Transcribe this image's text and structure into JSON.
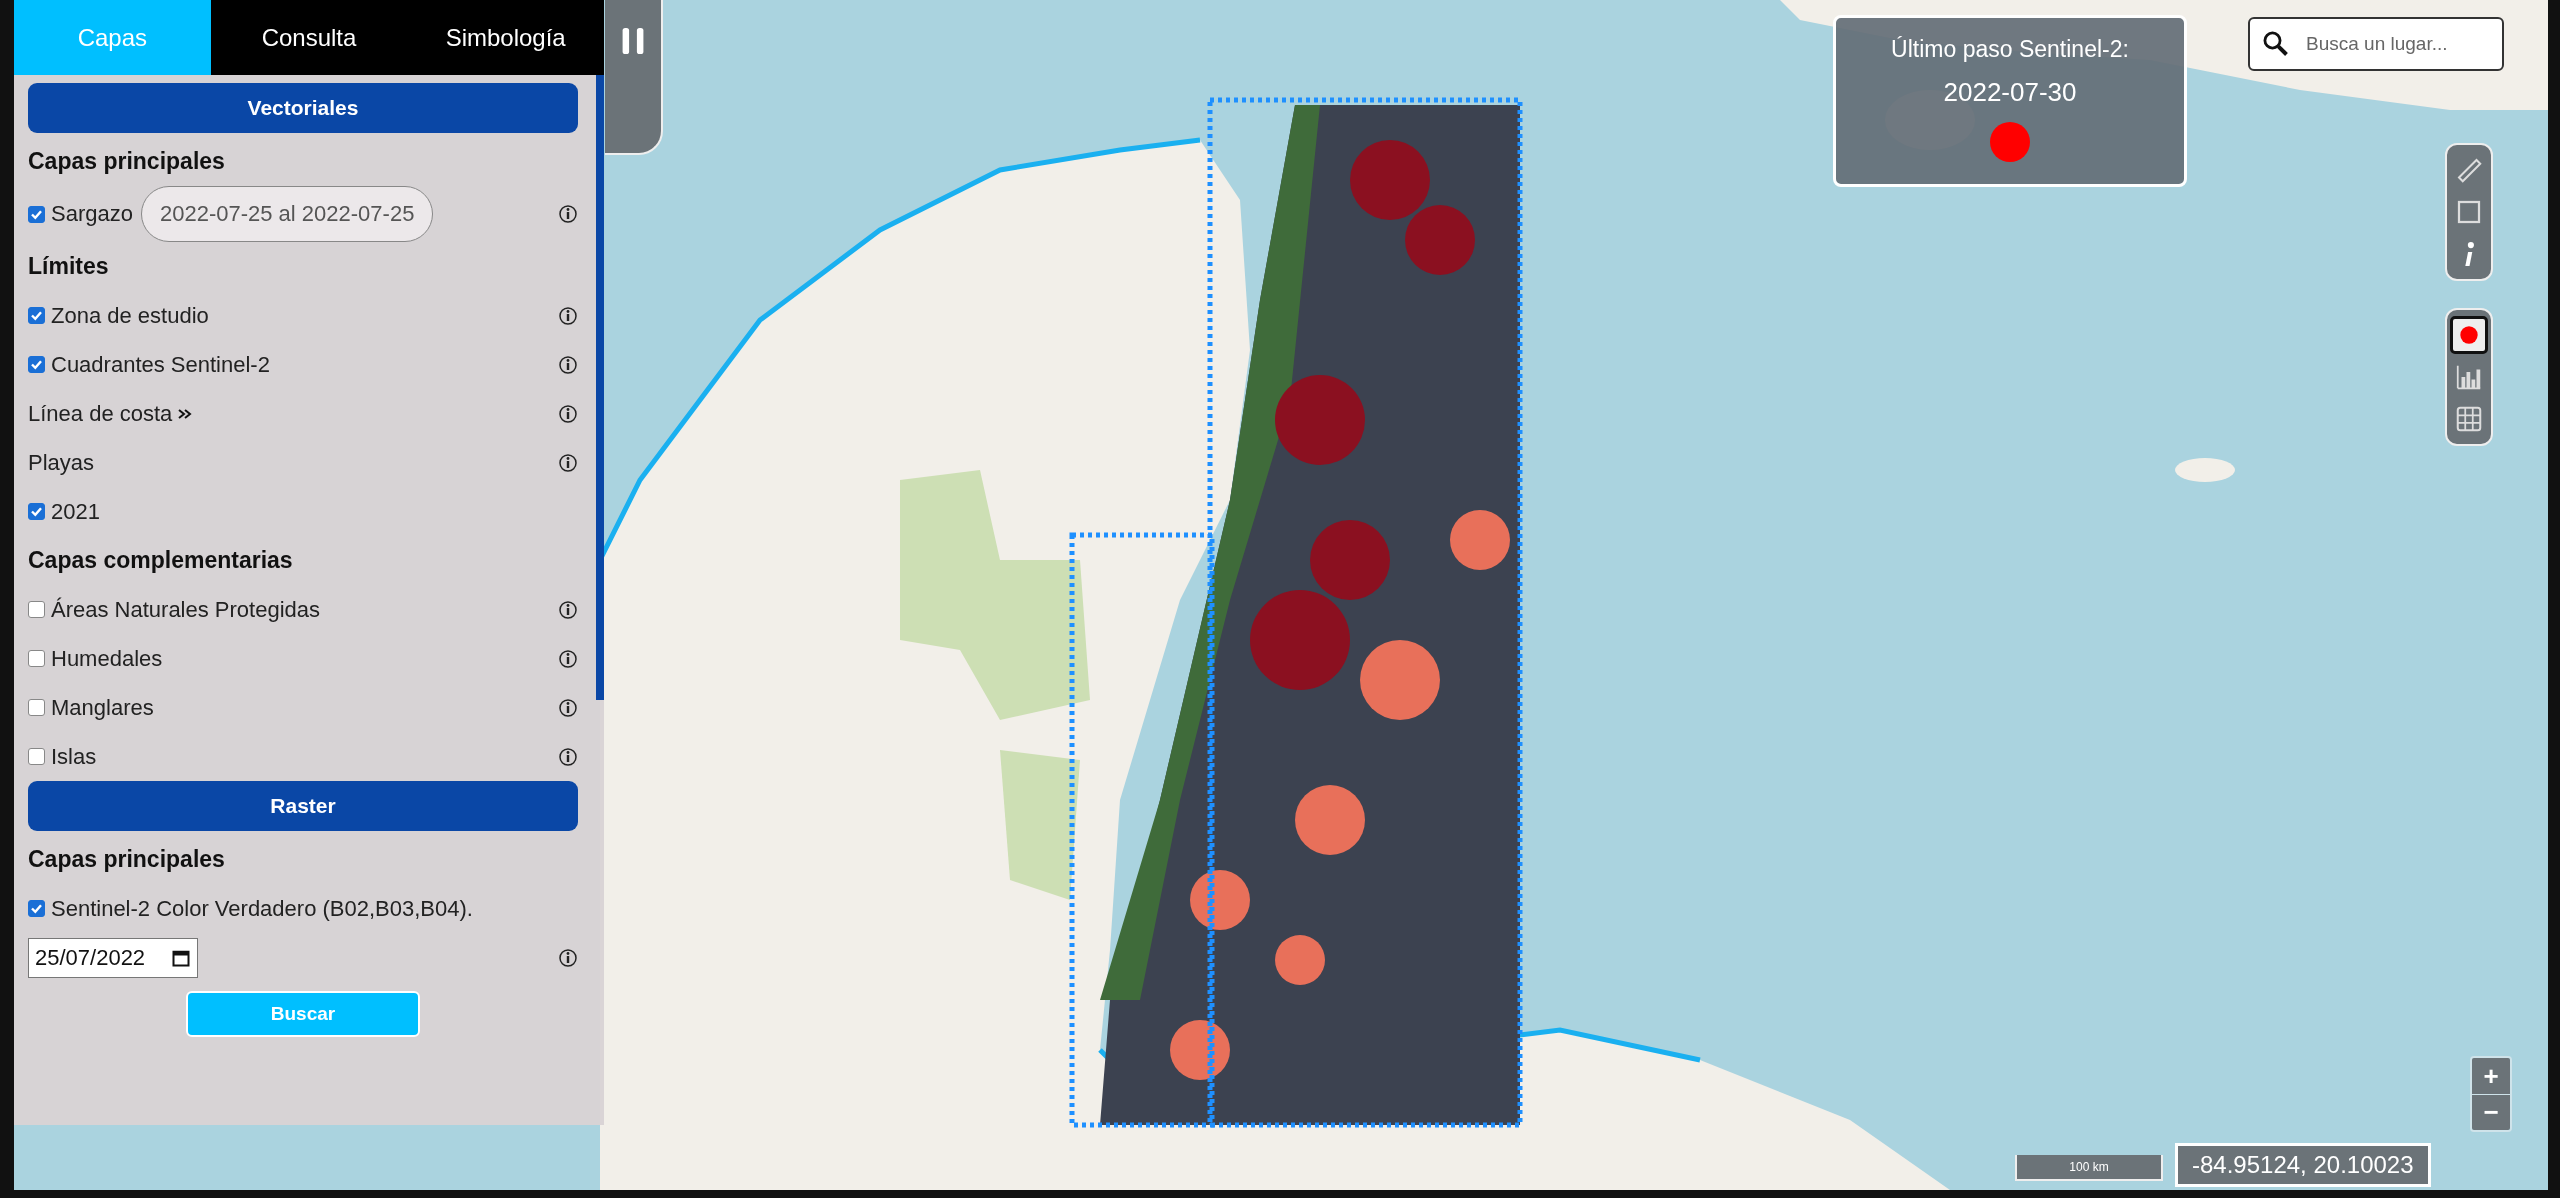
{
  "tabs": [
    {
      "label": "Capas",
      "selected": true
    },
    {
      "label": "Consulta",
      "selected": false
    },
    {
      "label": "Simbología",
      "selected": false
    }
  ],
  "sections": [
    {
      "button": "Vectoriales",
      "groups": [
        {
          "heading": "Capas principales",
          "items": [
            {
              "kind": "date-range",
              "label": "Sargazo",
              "checked": true,
              "range": "2022-07-25 al 2022-07-25",
              "info": true
            }
          ]
        },
        {
          "heading": "Límites",
          "items": [
            {
              "kind": "checkbox",
              "label": "Zona de estudio",
              "checked": true,
              "info": true
            },
            {
              "kind": "checkbox",
              "label": "Cuadrantes Sentinel-2",
              "checked": true,
              "info": true
            },
            {
              "kind": "expander",
              "label": "Línea de costa",
              "info": true
            },
            {
              "kind": "text",
              "label": "Playas",
              "info": true
            },
            {
              "kind": "checkbox",
              "label": "2021",
              "checked": true,
              "info": false
            }
          ]
        },
        {
          "heading": "Capas complementarias",
          "items": [
            {
              "kind": "checkbox",
              "label": "Áreas Naturales Protegidas",
              "checked": false,
              "info": true
            },
            {
              "kind": "checkbox",
              "label": "Humedales",
              "checked": false,
              "info": true
            },
            {
              "kind": "checkbox",
              "label": "Manglares",
              "checked": false,
              "info": true
            },
            {
              "kind": "checkbox",
              "label": "Islas",
              "checked": false,
              "info": true
            }
          ]
        }
      ]
    },
    {
      "button": "Raster",
      "groups": [
        {
          "heading": "Capas principales",
          "items": [
            {
              "kind": "checkbox",
              "label": "Sentinel-2 Color Verdadero (B02,B03,B04).",
              "checked": true,
              "info": false
            },
            {
              "kind": "date",
              "value": "25/07/2022",
              "info": true
            },
            {
              "kind": "action",
              "label": "Buscar"
            }
          ]
        }
      ]
    }
  ],
  "last_pass": {
    "title": "Último paso Sentinel-2:",
    "date": "2022-07-30"
  },
  "search": {
    "placeholder": "Busca un lugar..."
  },
  "layer_tools": [
    {
      "selected": true
    },
    {
      "selected": false
    },
    {
      "selected": false
    }
  ],
  "zoom": [
    "+",
    "−"
  ],
  "scale": "100 km",
  "coordinates": "-84.95124, 20.10023"
}
